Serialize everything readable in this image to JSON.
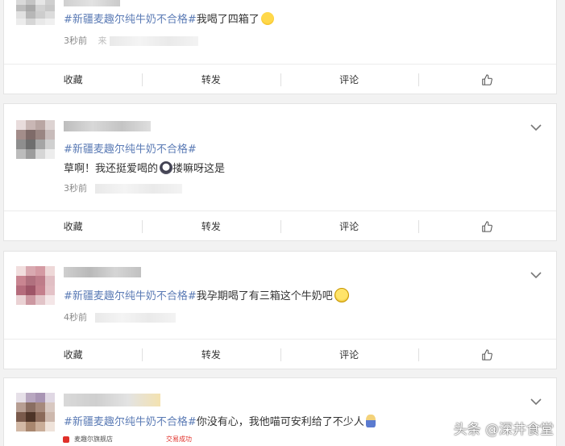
{
  "posts": [
    {
      "topic": "#新疆麦趣尔纯牛奶不合格#",
      "text": "我喝了四箱了",
      "emoji_icon": "crying-face-emoji",
      "time": "3秒前",
      "meta_char": "来"
    },
    {
      "topic": "#新疆麦趣尔纯牛奶不合格#",
      "text": "草啊！我还挺爱喝的",
      "text_after": "搂嘛呀这是",
      "emoji_icon": "shocked-face-emoji",
      "time": "3秒前"
    },
    {
      "topic": "#新疆麦趣尔纯牛奶不合格#",
      "text": "我孕期喝了有三箱这个牛奶吧",
      "emoji_icon": "smiling-face-emoji",
      "time": "4秒前"
    },
    {
      "topic": "#新疆麦趣尔纯牛奶不合格#",
      "text": "你没有心，我他喵可安利给了不少人",
      "emoji_icon": "person-emoji"
    }
  ],
  "actions": {
    "collect": "收藏",
    "repost": "转发",
    "comment": "评论",
    "like_icon": "thumbs-up-icon"
  },
  "strip": {
    "shop": "麦趣尔旗舰店",
    "status": "交易成功"
  },
  "watermark": "头条 @深井食堂",
  "colors": {
    "topic": "#5b7bb5",
    "background": "#f2f2f2",
    "card": "#ffffff"
  }
}
